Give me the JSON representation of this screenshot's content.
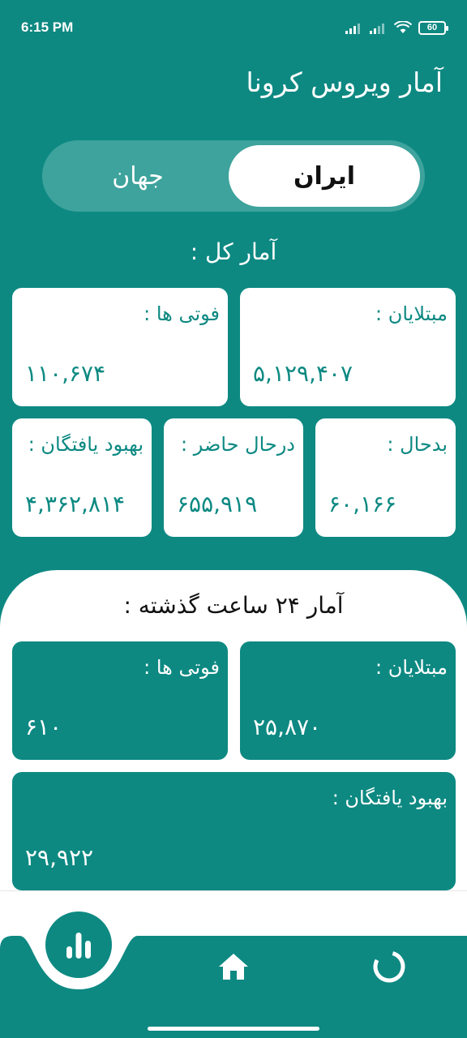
{
  "status_bar": {
    "time": "6:15 PM",
    "battery": "60"
  },
  "header": {
    "title": "آمار ویروس کرونا"
  },
  "region_toggle": {
    "active": "ایران",
    "inactive": "جهان"
  },
  "total_stats": {
    "title": "آمار کل :",
    "infected": {
      "label": "مبتلایان :",
      "value": "۵,۱۲۹,۴۰۷"
    },
    "deaths": {
      "label": "فوتی ها :",
      "value": "۱۱۰,۶۷۴"
    },
    "critical": {
      "label": "بدحال :",
      "value": "۶۰,۱۶۶"
    },
    "active": {
      "label": "درحال حاضر :",
      "value": "۶۵۵,۹۱۹"
    },
    "recovered": {
      "label": "بهبود یافتگان :",
      "value": "۴,۳۶۲,۸۱۴"
    }
  },
  "daily_stats": {
    "title": "آمار ۲۴ ساعت گذشته :",
    "infected": {
      "label": "مبتلایان :",
      "value": "۲۵,۸۷۰"
    },
    "deaths": {
      "label": "فوتی ها :",
      "value": "۶۱۰"
    },
    "recovered": {
      "label": "بهبود یافتگان :",
      "value": "۲۹,۹۲۲"
    }
  },
  "nav": {
    "items": [
      "stats-icon",
      "home-icon",
      "loading-icon"
    ]
  },
  "colors": {
    "primary": "#0d8982",
    "toggle_track": "#3da39c",
    "white": "#ffffff"
  }
}
